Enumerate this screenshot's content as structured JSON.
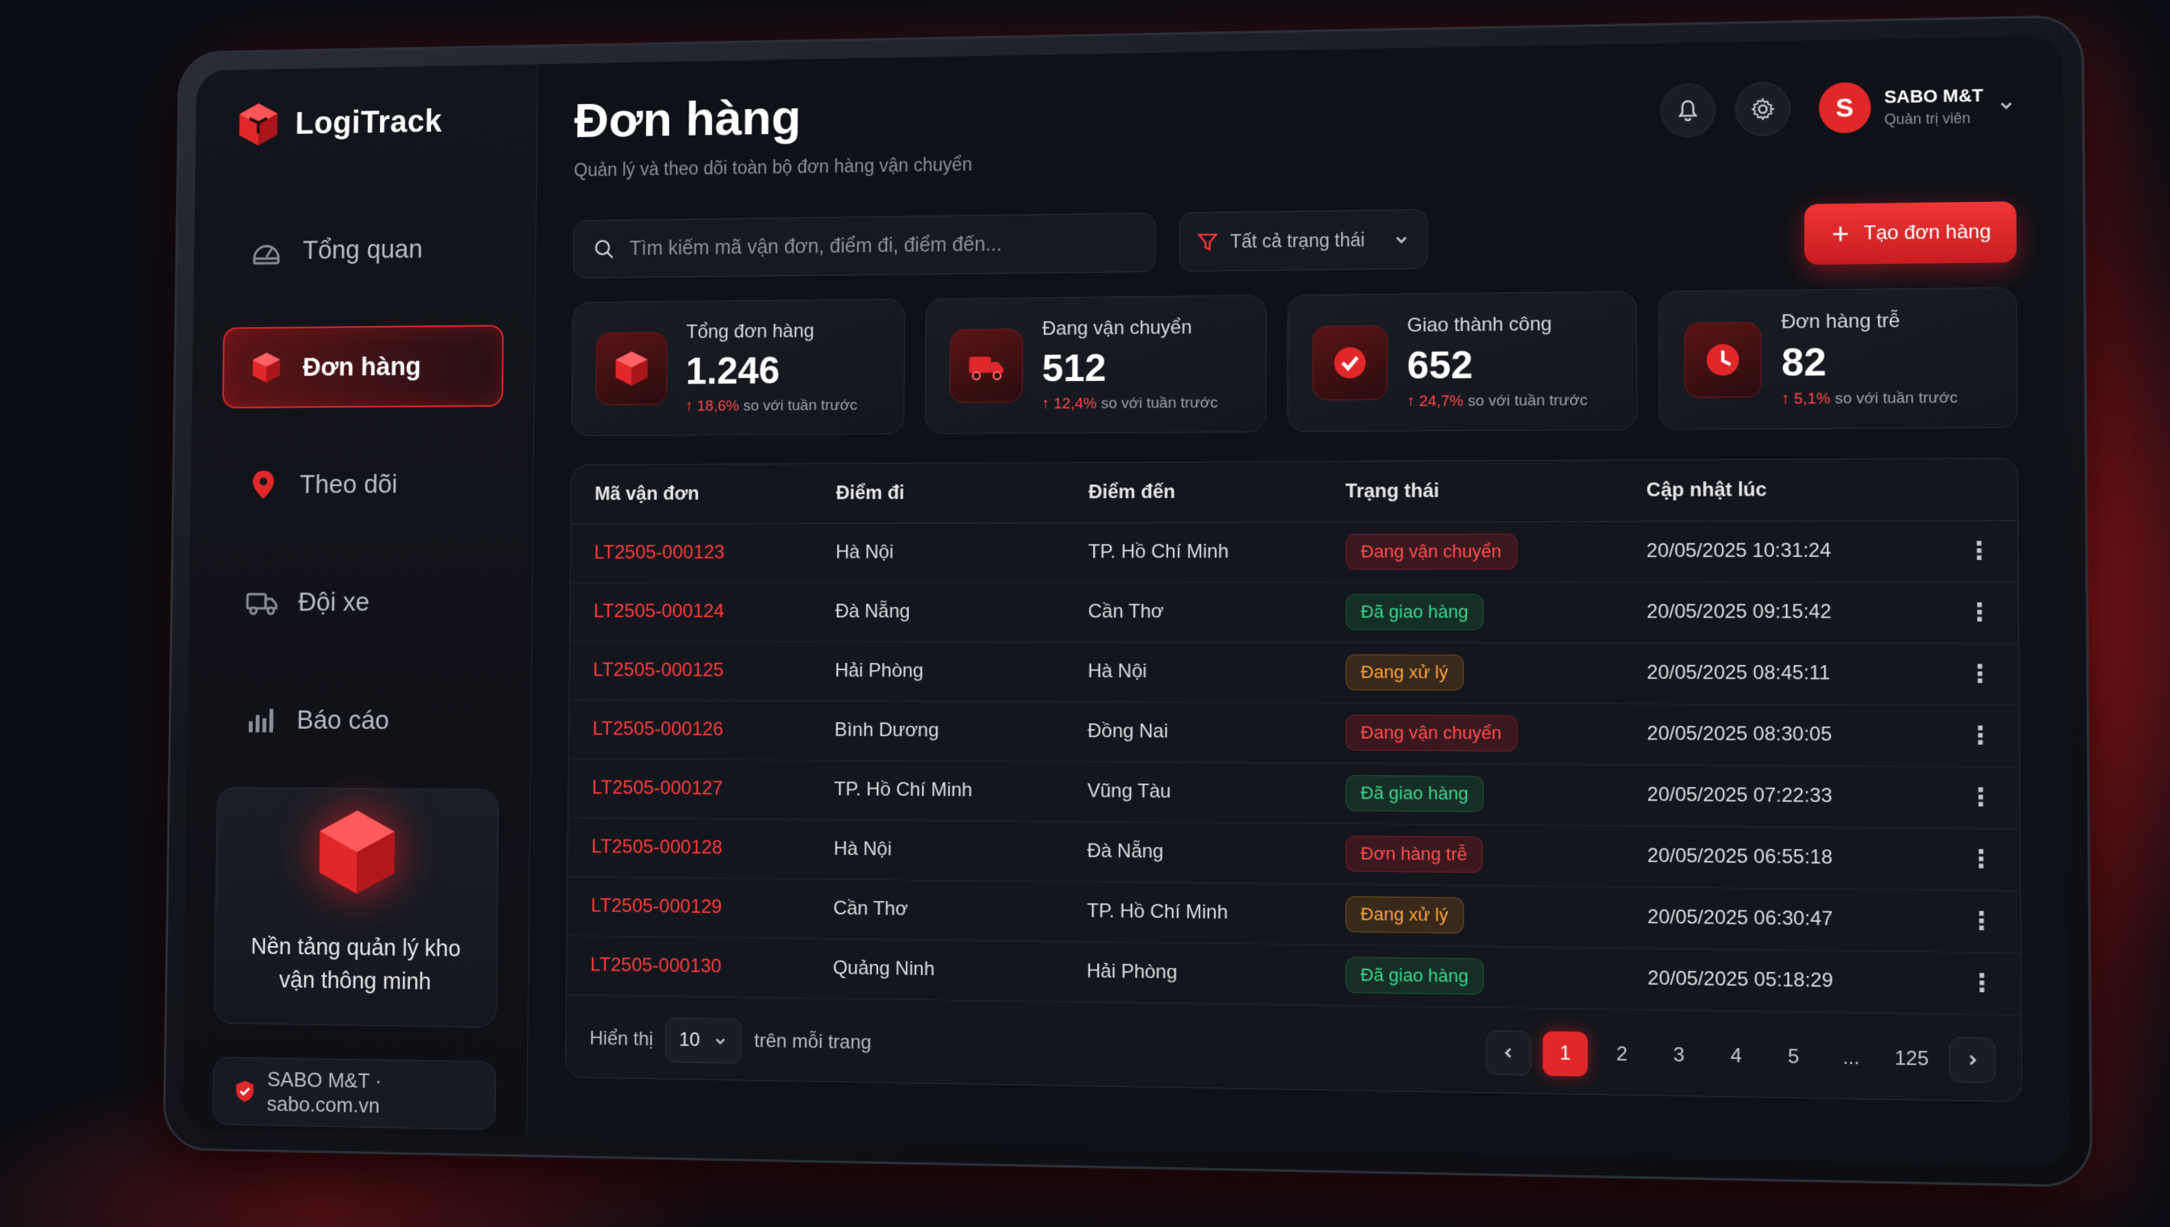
{
  "brand": {
    "name": "LogiTrack"
  },
  "sidebar": {
    "items": [
      {
        "label": "Tổng quan",
        "icon": "dashboard-gauge-icon",
        "active": false
      },
      {
        "label": "Đơn hàng",
        "icon": "box-icon",
        "active": true
      },
      {
        "label": "Theo dõi",
        "icon": "map-pin-icon",
        "active": false
      },
      {
        "label": "Đội xe",
        "icon": "truck-icon",
        "active": false
      },
      {
        "label": "Báo cáo",
        "icon": "bar-chart-icon",
        "active": false
      }
    ],
    "promo_text": "Nền tảng quản lý kho vận thông minh",
    "footer": "SABO M&T · sabo.com.vn"
  },
  "header": {
    "title": "Đơn hàng",
    "subtitle": "Quản lý và theo dõi toàn bộ đơn hàng vận chuyển",
    "user": {
      "initial": "S",
      "name": "SABO M&T",
      "role": "Quản trị viên"
    }
  },
  "toolbar": {
    "search_placeholder": "Tìm kiếm mã vận đơn, điểm đi, điểm đến...",
    "filter_label": "Tất cả trạng thái",
    "create_label": "Tạo đơn hàng"
  },
  "stats": [
    {
      "label": "Tổng đơn hàng",
      "value": "1.246",
      "delta": "18,6%",
      "delta_text": "so với tuần trước",
      "icon": "box-icon"
    },
    {
      "label": "Đang vận chuyển",
      "value": "512",
      "delta": "12,4%",
      "delta_text": "so với tuần trước",
      "icon": "truck-icon"
    },
    {
      "label": "Giao thành công",
      "value": "652",
      "delta": "24,7%",
      "delta_text": "so với tuần trước",
      "icon": "check-circle-icon"
    },
    {
      "label": "Đơn hàng trễ",
      "value": "82",
      "delta": "5,1%",
      "delta_text": "so với tuần trước",
      "icon": "clock-icon"
    }
  ],
  "table": {
    "headers": [
      "Mã vận đơn",
      "Điểm đi",
      "Điểm đến",
      "Trạng thái",
      "Cập nhật lúc"
    ],
    "rows": [
      {
        "code": "LT2505-000123",
        "from": "Hà Nội",
        "to": "TP. Hồ Chí Minh",
        "status": "Đang vận chuyển",
        "tone": "red",
        "updated": "20/05/2025 10:31:24"
      },
      {
        "code": "LT2505-000124",
        "from": "Đà Nẵng",
        "to": "Cần Thơ",
        "status": "Đã giao hàng",
        "tone": "green",
        "updated": "20/05/2025 09:15:42"
      },
      {
        "code": "LT2505-000125",
        "from": "Hải Phòng",
        "to": "Hà Nội",
        "status": "Đang xử lý",
        "tone": "orange",
        "updated": "20/05/2025 08:45:11"
      },
      {
        "code": "LT2505-000126",
        "from": "Bình Dương",
        "to": "Đồng Nai",
        "status": "Đang vận chuyển",
        "tone": "red",
        "updated": "20/05/2025 08:30:05"
      },
      {
        "code": "LT2505-000127",
        "from": "TP. Hồ Chí Minh",
        "to": "Vũng Tàu",
        "status": "Đã giao hàng",
        "tone": "green",
        "updated": "20/05/2025 07:22:33"
      },
      {
        "code": "LT2505-000128",
        "from": "Hà Nội",
        "to": "Đà Nẵng",
        "status": "Đơn hàng trễ",
        "tone": "red",
        "updated": "20/05/2025 06:55:18"
      },
      {
        "code": "LT2505-000129",
        "from": "Cần Thơ",
        "to": "TP. Hồ Chí Minh",
        "status": "Đang xử lý",
        "tone": "orange",
        "updated": "20/05/2025 06:30:47"
      },
      {
        "code": "LT2505-000130",
        "from": "Quảng Ninh",
        "to": "Hải Phòng",
        "status": "Đã giao hàng",
        "tone": "green",
        "updated": "20/05/2025 05:18:29"
      }
    ]
  },
  "pagination": {
    "show_label": "Hiển thị",
    "per_page": "10",
    "per_page_suffix": "trên mỗi trang",
    "pages": [
      "1",
      "2",
      "3",
      "4",
      "5",
      "...",
      "125"
    ],
    "current": "1"
  },
  "colors": {
    "accent": "#e0282a",
    "success": "#3fd68a",
    "warning": "#ffa43a"
  }
}
